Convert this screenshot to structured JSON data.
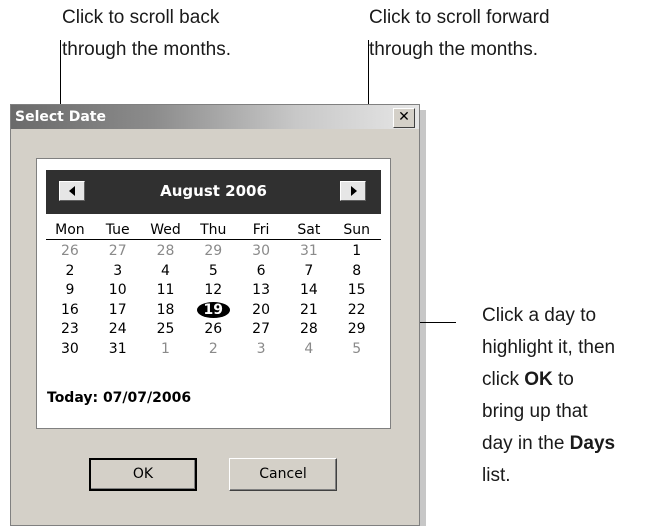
{
  "callouts": {
    "back": [
      "Click to scroll back",
      "through the months."
    ],
    "forward": [
      "Click to scroll forward",
      "through the months."
    ],
    "day": {
      "line1": "Click a day to",
      "line2": "highlight it, then",
      "line3_pre": "click ",
      "line3_bold": "OK",
      "line3_post": " to",
      "line4": "bring up that",
      "line5_pre": "day in the ",
      "line5_bold": "Days",
      "line6": "list."
    }
  },
  "dialog": {
    "title": "Select Date",
    "close_label": "✕",
    "month_label": "August 2006",
    "weekdays": [
      "Mon",
      "Tue",
      "Wed",
      "Thu",
      "Fri",
      "Sat",
      "Sun"
    ],
    "weeks": [
      [
        "26",
        "27",
        "28",
        "29",
        "30",
        "31",
        "1"
      ],
      [
        "2",
        "3",
        "4",
        "5",
        "6",
        "7",
        "8"
      ],
      [
        "9",
        "10",
        "11",
        "12",
        "13",
        "14",
        "15"
      ],
      [
        "16",
        "17",
        "18",
        "19",
        "20",
        "21",
        "22"
      ],
      [
        "23",
        "24",
        "25",
        "26",
        "27",
        "28",
        "29"
      ],
      [
        "30",
        "31",
        "1",
        "2",
        "3",
        "4",
        "5"
      ]
    ],
    "selected_day": "19",
    "today_label": "Today: 07/07/2006",
    "ok_label": "OK",
    "cancel_label": "Cancel"
  }
}
